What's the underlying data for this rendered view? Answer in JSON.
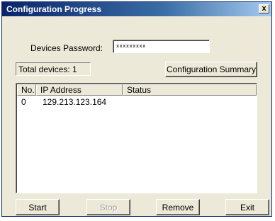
{
  "window": {
    "title": "Configuration Progress",
    "close_label": "x"
  },
  "password": {
    "label": "Devices Password:",
    "value": "xxxxxxxxx"
  },
  "total_devices": "Total devices: 1",
  "buttons": {
    "summary": "Configuration Summary",
    "start": "Start",
    "stop": "Stop",
    "remove": "Remove",
    "exit": "Exit"
  },
  "list": {
    "columns": [
      "No.",
      "IP Address",
      "Status"
    ],
    "rows": [
      {
        "no": "0",
        "ip": "129.213.123.164",
        "status": ""
      }
    ]
  },
  "colors": {
    "title_bar_start": "#0a246a",
    "title_bar_end": "#a6caf0",
    "window_bg": "#ece9d8"
  }
}
